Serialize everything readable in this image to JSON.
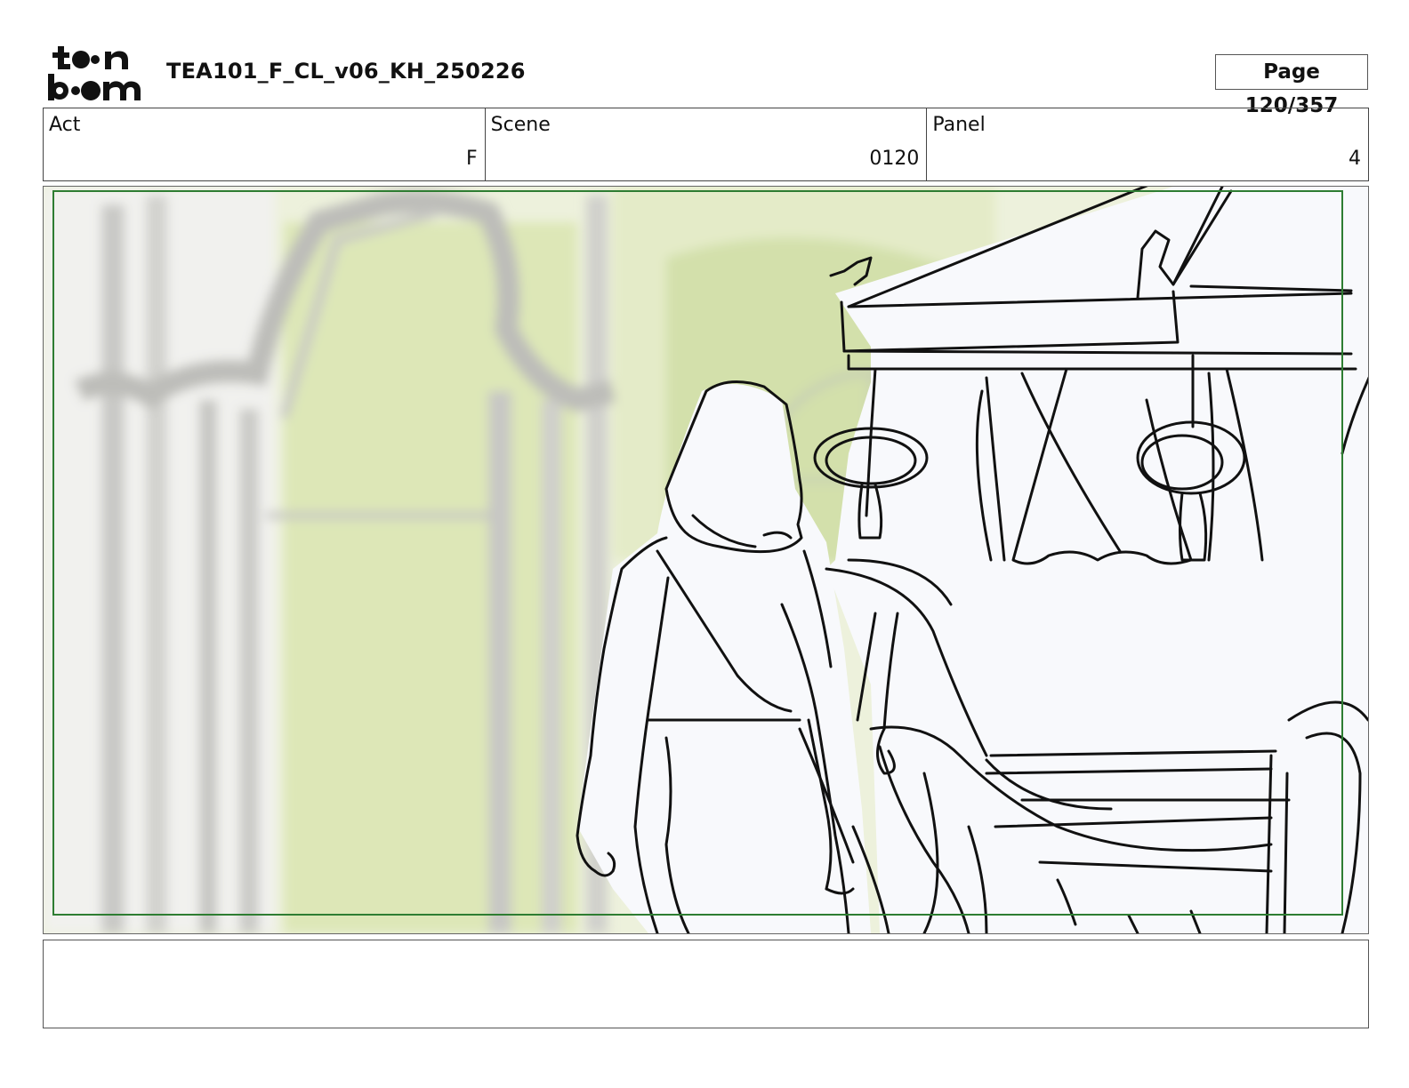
{
  "header": {
    "logo_text": "toon boom",
    "title": "TEA101_F_CL_v06_KH_250226",
    "page": "Page 120/357"
  },
  "info": {
    "act_label": "Act",
    "act_value": "F",
    "scene_label": "Scene",
    "scene_value": "0120",
    "panel_label": "Panel",
    "panel_value": "4"
  },
  "notes": {
    "text": ""
  },
  "colors": {
    "safe_area_border": "#2e7d32",
    "background_tint": "#e6edc9"
  }
}
